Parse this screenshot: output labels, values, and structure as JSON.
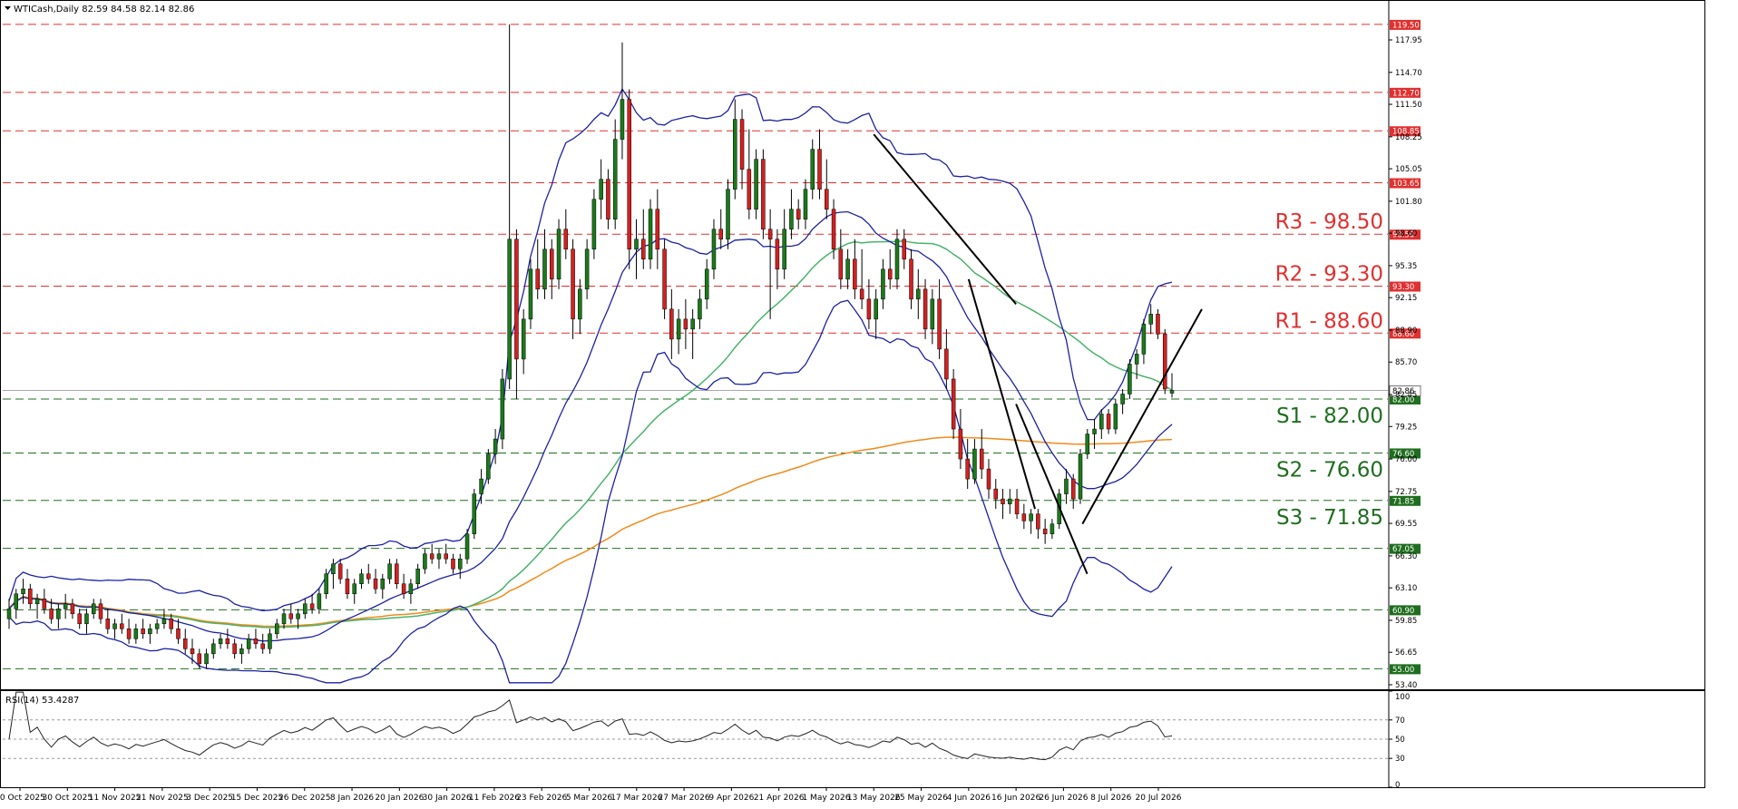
{
  "window": {
    "title": "WTICash,Daily  82.59 84.58 82.14 82.86",
    "menu_icon": "triangle-down-icon"
  },
  "colors": {
    "background": "#ffffff",
    "frame": "#000000",
    "bull_candle": "#1a7a1a",
    "bear_candle": "#d42020",
    "wick": "#000000",
    "bollinger": "#1c22a3",
    "ma_green": "#49b36a",
    "ma_orange": "#f28a1a",
    "resistance": "#e03030",
    "support": "#1f6e1f",
    "trendline": "#000000",
    "rsi_line": "#222222",
    "rsi_level": "#999999",
    "current_price_line": "#a9a9a9"
  },
  "chart_data": [
    {
      "type": "candlestick",
      "title": "WTICash,Daily",
      "ohlc_last": {
        "open": 82.59,
        "high": 84.58,
        "low": 82.14,
        "close": 82.86
      },
      "ylim": [
        53.4,
        121.0
      ],
      "y_ticks": [
        "117.95",
        "114.70",
        "111.50",
        "108.25",
        "105.05",
        "101.80",
        "98.60",
        "95.35",
        "92.15",
        "88.90",
        "85.70",
        "82.45",
        "79.25",
        "76.00",
        "72.75",
        "69.55",
        "66.30",
        "63.10",
        "59.85",
        "56.65",
        "53.40"
      ],
      "x_ticks": [
        "20 Oct 2025",
        "30 Oct 2025",
        "11 Nov 2025",
        "21 Nov 2025",
        "3 Dec 2025",
        "15 Dec 2025",
        "26 Dec 2025",
        "8 Jan 2026",
        "20 Jan 2026",
        "30 Jan 2026",
        "11 Feb 2026",
        "23 Feb 2026",
        "5 Mar 2026",
        "17 Mar 2026",
        "27 Mar 2026",
        "9 Apr 2026",
        "21 Apr 2026",
        "1 May 2026",
        "13 May 2026",
        "25 May 2026",
        "4 Jun 2026",
        "16 Jun 2026",
        "26 Jun 2026",
        "8 Jul 2026",
        "20 Jul 2026"
      ],
      "current_price": {
        "value": 82.86,
        "label": "82.86"
      },
      "price_levels": [
        {
          "value": 119.5,
          "label": "119.50",
          "kind": "resistance"
        },
        {
          "value": 112.7,
          "label": "112.70",
          "kind": "resistance"
        },
        {
          "value": 108.85,
          "label": "108.85",
          "kind": "resistance"
        },
        {
          "value": 103.65,
          "label": "103.65",
          "kind": "resistance"
        },
        {
          "value": 98.5,
          "label": "98.50",
          "kind": "resistance",
          "text": "R3 - 98.50"
        },
        {
          "value": 93.3,
          "label": "93.30",
          "kind": "resistance",
          "text": "R2 - 93.30"
        },
        {
          "value": 88.6,
          "label": "88.60",
          "kind": "resistance",
          "text": "R1 - 88.60"
        },
        {
          "value": 82.0,
          "label": "82.00",
          "kind": "support",
          "text": "S1 - 82.00"
        },
        {
          "value": 76.6,
          "label": "76.60",
          "kind": "support",
          "text": "S2 - 76.60"
        },
        {
          "value": 71.85,
          "label": "71.85",
          "kind": "support",
          "text": "S3 - 71.85"
        },
        {
          "value": 67.05,
          "label": "67.05",
          "kind": "support"
        },
        {
          "value": 60.9,
          "label": "60.90",
          "kind": "support"
        },
        {
          "value": 55.0,
          "label": "55.00",
          "kind": "support"
        }
      ],
      "candles": [
        [
          60,
          62,
          59,
          61
        ],
        [
          61,
          63,
          60,
          62.5
        ],
        [
          62.5,
          64,
          61.5,
          63
        ],
        [
          63,
          63.5,
          61,
          61.5
        ],
        [
          61.5,
          62.5,
          60,
          62
        ],
        [
          62,
          63,
          60.5,
          61
        ],
        [
          61,
          62,
          59.5,
          60
        ],
        [
          60,
          61.5,
          59,
          61
        ],
        [
          61,
          62.5,
          60,
          61.5
        ],
        [
          61.5,
          62,
          60,
          60.5
        ],
        [
          60.5,
          61,
          59,
          59.5
        ],
        [
          59.5,
          61,
          58.5,
          60.5
        ],
        [
          60.5,
          62,
          60,
          61.5
        ],
        [
          61.5,
          62,
          59.5,
          60
        ],
        [
          60,
          61,
          58.5,
          59
        ],
        [
          59,
          60,
          58,
          59.5
        ],
        [
          59.5,
          60.5,
          58.5,
          59
        ],
        [
          59,
          60,
          57.5,
          58
        ],
        [
          58,
          59.5,
          57.5,
          59
        ],
        [
          59,
          60,
          58,
          58.5
        ],
        [
          58.5,
          59.5,
          57.5,
          59
        ],
        [
          59,
          60,
          58.5,
          59.5
        ],
        [
          59.5,
          61,
          59,
          60
        ],
        [
          60,
          60.5,
          58.5,
          59
        ],
        [
          59,
          60,
          57.5,
          58
        ],
        [
          58,
          59,
          56.5,
          57
        ],
        [
          57,
          58,
          55.5,
          56.5
        ],
        [
          56.5,
          57,
          55,
          55.5
        ],
        [
          55.5,
          57,
          55,
          56.5
        ],
        [
          56.5,
          58,
          56,
          57.5
        ],
        [
          57.5,
          58.5,
          57,
          58
        ],
        [
          58,
          59,
          57,
          57.5
        ],
        [
          57.5,
          58,
          56,
          56.5
        ],
        [
          56.5,
          57.5,
          55.5,
          57
        ],
        [
          57,
          58.5,
          56.5,
          58
        ],
        [
          58,
          59,
          57,
          57.5
        ],
        [
          57.5,
          58.5,
          56.5,
          57
        ],
        [
          57,
          59,
          56.5,
          58.5
        ],
        [
          58.5,
          60,
          58,
          59.5
        ],
        [
          59.5,
          61,
          59,
          60.5
        ],
        [
          60.5,
          61.5,
          59.5,
          60
        ],
        [
          60,
          61,
          59,
          60.5
        ],
        [
          60.5,
          62,
          60,
          61.5
        ],
        [
          61.5,
          62.5,
          60.5,
          61
        ],
        [
          61,
          63,
          60.5,
          62.5
        ],
        [
          62.5,
          65,
          62,
          64.5
        ],
        [
          64.5,
          66,
          63,
          65.5
        ],
        [
          65.5,
          66,
          63.5,
          64
        ],
        [
          64,
          65,
          62,
          62.5
        ],
        [
          62.5,
          64,
          61.5,
          63.5
        ],
        [
          63.5,
          65,
          63,
          64.5
        ],
        [
          64.5,
          65.5,
          63.5,
          64
        ],
        [
          64,
          65,
          62.5,
          63
        ],
        [
          63,
          64.5,
          62,
          64
        ],
        [
          64,
          66,
          63.5,
          65.5
        ],
        [
          65.5,
          66,
          63,
          63.5
        ],
        [
          63.5,
          64.5,
          62,
          62.5
        ],
        [
          62.5,
          64,
          61.5,
          63.5
        ],
        [
          63.5,
          65.5,
          63,
          65
        ],
        [
          65,
          67,
          64.5,
          66.5
        ],
        [
          66.5,
          67.5,
          65.5,
          66
        ],
        [
          66,
          67,
          65,
          66.5
        ],
        [
          66.5,
          67.5,
          65.5,
          66
        ],
        [
          66,
          66.5,
          64.5,
          65
        ],
        [
          65,
          66.5,
          64,
          66
        ],
        [
          66,
          69,
          65.5,
          68.5
        ],
        [
          68.5,
          73,
          68,
          72.5
        ],
        [
          72.5,
          75,
          71.5,
          74
        ],
        [
          74,
          77,
          73.5,
          76.5
        ],
        [
          76.5,
          79,
          75.5,
          78
        ],
        [
          78,
          85,
          77,
          84
        ],
        [
          84,
          119.5,
          83,
          98
        ],
        [
          98,
          99,
          82,
          86
        ],
        [
          86,
          91,
          84.5,
          90
        ],
        [
          90,
          96,
          89,
          95
        ],
        [
          95,
          98,
          92,
          93
        ],
        [
          93,
          99,
          92,
          97
        ],
        [
          97,
          98,
          92,
          94
        ],
        [
          94,
          100,
          93,
          99
        ],
        [
          99,
          101,
          96,
          97
        ],
        [
          97,
          98,
          88,
          90
        ],
        [
          90,
          94,
          88.5,
          93
        ],
        [
          93,
          98,
          92,
          97
        ],
        [
          97,
          103,
          96,
          102
        ],
        [
          102,
          106,
          100,
          104
        ],
        [
          104,
          105,
          99,
          100
        ],
        [
          100,
          110,
          99,
          108
        ],
        [
          108,
          117.7,
          106,
          112
        ],
        [
          112,
          113,
          95,
          97
        ],
        [
          97,
          100,
          94,
          98
        ],
        [
          98,
          101,
          95,
          96
        ],
        [
          96,
          102,
          95,
          101
        ],
        [
          101,
          103,
          95,
          97
        ],
        [
          97,
          98,
          90,
          91
        ],
        [
          91,
          93,
          86,
          88
        ],
        [
          88,
          91,
          86.5,
          90
        ],
        [
          90,
          92,
          87,
          89
        ],
        [
          89,
          91,
          86,
          90
        ],
        [
          90,
          93,
          89,
          92
        ],
        [
          92,
          96,
          91,
          95
        ],
        [
          95,
          100,
          94,
          99
        ],
        [
          99,
          101,
          97,
          98
        ],
        [
          98,
          104,
          97,
          103
        ],
        [
          103,
          112,
          102,
          110
        ],
        [
          110,
          111,
          103,
          105
        ],
        [
          105,
          109,
          100,
          101
        ],
        [
          101,
          107,
          100,
          106
        ],
        [
          106,
          107,
          98,
          99
        ],
        [
          99,
          101,
          90,
          98
        ],
        [
          98,
          99,
          93,
          95
        ],
        [
          95,
          101,
          94,
          99
        ],
        [
          99,
          103,
          98,
          101
        ],
        [
          101,
          102,
          99,
          100
        ],
        [
          100,
          104,
          99,
          103
        ],
        [
          103,
          108,
          102,
          107
        ],
        [
          107,
          109,
          102,
          103
        ],
        [
          103,
          106,
          100,
          101
        ],
        [
          101,
          102,
          96,
          97
        ],
        [
          97,
          99,
          93,
          94
        ],
        [
          94,
          97,
          93,
          96
        ],
        [
          96,
          98,
          92,
          93
        ],
        [
          93,
          97,
          91,
          92
        ],
        [
          92,
          94,
          89,
          90
        ],
        [
          90,
          93,
          88,
          92
        ],
        [
          92,
          96,
          91,
          95
        ],
        [
          95,
          97,
          93,
          94
        ],
        [
          94,
          99,
          93,
          98
        ],
        [
          98,
          99,
          95,
          96
        ],
        [
          96,
          97,
          91,
          92
        ],
        [
          92,
          95,
          90,
          93
        ],
        [
          93,
          94,
          88,
          89
        ],
        [
          89,
          93,
          87.5,
          92
        ],
        [
          92,
          94,
          86,
          87
        ],
        [
          87,
          89,
          83,
          84
        ],
        [
          84,
          85,
          78,
          79
        ],
        [
          79,
          81,
          75,
          76
        ],
        [
          76,
          78,
          73,
          74
        ],
        [
          74,
          78,
          73.5,
          77
        ],
        [
          77,
          79,
          74,
          75
        ],
        [
          75,
          76,
          72,
          73
        ],
        [
          73,
          74,
          71,
          72
        ],
        [
          72,
          73,
          70,
          71.5
        ],
        [
          71.5,
          73,
          70.5,
          72
        ],
        [
          72,
          73,
          70,
          70.5
        ],
        [
          70.5,
          71.5,
          69,
          69.8
        ],
        [
          69.8,
          71,
          68.5,
          70.5
        ],
        [
          70.5,
          71,
          68,
          69
        ],
        [
          69,
          70,
          67.5,
          68.5
        ],
        [
          68.5,
          70,
          68,
          69.5
        ],
        [
          69.5,
          73,
          69,
          72.5
        ],
        [
          72.5,
          75,
          71.5,
          74
        ],
        [
          74,
          74.5,
          71,
          72
        ],
        [
          72,
          77,
          71.5,
          76.5
        ],
        [
          76.5,
          79,
          76,
          78.5
        ],
        [
          78.5,
          80,
          77,
          79
        ],
        [
          79,
          81,
          78,
          80.5
        ],
        [
          80.5,
          81,
          78.5,
          79
        ],
        [
          79,
          82,
          78.5,
          81.5
        ],
        [
          81.5,
          83,
          80.5,
          82.5
        ],
        [
          82.5,
          86,
          82,
          85.5
        ],
        [
          85.5,
          87,
          84,
          86.5
        ],
        [
          86.5,
          90,
          85.5,
          89.5
        ],
        [
          89.5,
          91.5,
          88.5,
          90.5
        ],
        [
          90.5,
          91,
          88,
          88.5
        ],
        [
          88.5,
          89,
          82.5,
          83
        ],
        [
          82.59,
          84.58,
          82.14,
          82.86
        ]
      ],
      "rsi": {
        "label": "RSI(14) 53.4287",
        "period": 14,
        "last_value": 53.4287,
        "ylim": [
          0,
          100
        ],
        "levels": [
          70,
          50,
          30
        ],
        "y_ticks": [
          "100",
          "70",
          "50",
          "30",
          "0"
        ]
      },
      "indicators": [
        "Bollinger Bands",
        "Moving Average (green)",
        "Moving Average (orange)"
      ],
      "trendlines": [
        {
          "from": {
            "date": "13 May 2026",
            "value": 108.5
          },
          "to": {
            "date": "16 Jun 2026",
            "value": 91.5
          }
        },
        {
          "from": {
            "date": "4 Jun 2026",
            "value": 94
          },
          "to": {
            "date": "20 Jun 2026",
            "value": 71
          }
        },
        {
          "from": {
            "date": "16 Jun 2026",
            "value": 81.5
          },
          "to": {
            "date": "2 Jul 2026",
            "value": 64.5
          }
        },
        {
          "from": {
            "date": "30 Jun 2026",
            "value": 69.5
          },
          "to": {
            "date": "31 Jul 2026",
            "value": 91
          }
        }
      ]
    }
  ]
}
